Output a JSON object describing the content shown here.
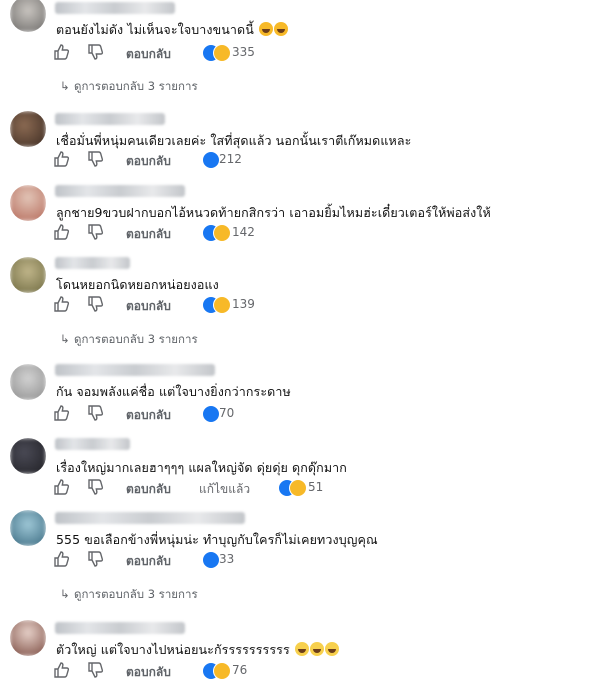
{
  "ui": {
    "reply_label": "ตอบกลับ"
  },
  "comments": [
    {
      "text": "ตอนยังไม่ดัง ไม่เห็นจะใจบางขนาดนี้",
      "emojis": [
        "laugh",
        "laugh"
      ],
      "count": "335",
      "thread": "ดูการตอบกลับ 3 รายการ",
      "edited": ""
    },
    {
      "text": "เชื่อมั่นพี่หนุ่มคนเดียวเลยค่ะ ใสที่สุดแล้ว นอกนั้นเราตีเก๊หมดแหละ",
      "emojis": [],
      "count": "212",
      "thread": "",
      "edited": ""
    },
    {
      "text": "ลูกชาย9ขวบฝากบอกไอ้หนวดท้ายกสิกรว่า เอาอมยิ้มไหมฮ่ะเดี๋ยวเตอร์ให้พ่อส่งให้",
      "emojis": [],
      "count": "142",
      "thread": "",
      "edited": ""
    },
    {
      "text": "โดนหยอกนิดหยอกหน่อยงอแง",
      "emojis": [],
      "count": "139",
      "thread": "ดูการตอบกลับ 3 รายการ",
      "edited": ""
    },
    {
      "text": "กัน จอมพลังแค่ชื่อ แต่ใจบางยิ่งกว่ากระดาษ",
      "emojis": [],
      "count": "70",
      "thread": "",
      "edited": ""
    },
    {
      "text": "เรื่องใหญ่มากเลยฮาๆๆๆ แผลใหญ่จัด ดุ่ยดุ่ย ดุกดุ๊กมาก",
      "emojis": [],
      "count": "51",
      "thread": "",
      "edited": "แก้ไขแล้ว"
    },
    {
      "text": "555 ขอเลือกข้างพี่หนุ่มน่ะ ทำบุญกับใครก็ไม่เคยทวงบุญคุณ",
      "emojis": [],
      "count": "33",
      "thread": "ดูการตอบกลับ 3 รายการ",
      "edited": ""
    },
    {
      "text": "ตัวใหญ่ แต่ใจบางไปหน่อยนะกัรรรรรรรรรร",
      "emojis": [
        "grin",
        "grin",
        "grin"
      ],
      "count": "76",
      "thread": "",
      "edited": ""
    }
  ]
}
